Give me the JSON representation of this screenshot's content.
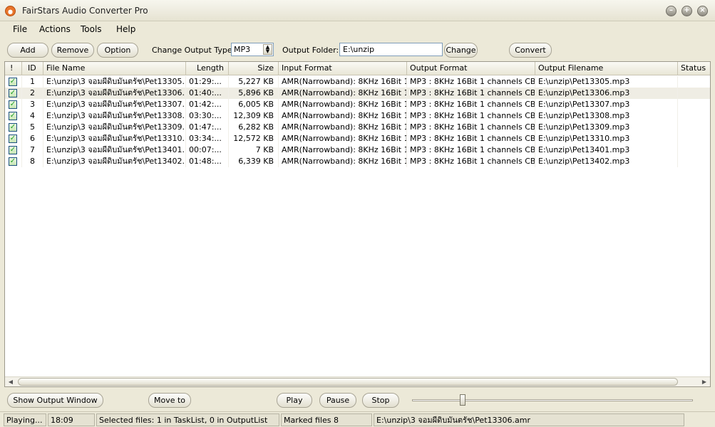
{
  "window": {
    "title": "FairStars Audio Converter Pro"
  },
  "menu": {
    "file": "File",
    "actions": "Actions",
    "tools": "Tools",
    "help": "Help"
  },
  "toolbar": {
    "add": "Add",
    "remove": "Remove",
    "option": "Option",
    "output_type_label": "Change Output Type:",
    "output_type_value": "MP3",
    "output_folder_label": "Output Folder:",
    "output_folder_value": "E:\\unzip",
    "change": "Change",
    "convert": "Convert"
  },
  "columns": [
    "!",
    "ID",
    "File Name",
    "Length",
    "Size",
    "Input Format",
    "Output Format",
    "Output Filename",
    "Status"
  ],
  "rows": [
    {
      "checked": true,
      "id": "1",
      "file": "E:\\unzip\\3 จอมผีดิบมันตรัช\\Pet13305...",
      "length": "01:29:...",
      "size": "5,227 KB",
      "input": "AMR(Narrowband): 8KHz 16Bit 1...",
      "output": "MP3 : 8KHz 16Bit 1 channels CB...",
      "outfile": "E:\\unzip\\Pet13305.mp3",
      "status": ""
    },
    {
      "checked": true,
      "id": "2",
      "file": "E:\\unzip\\3 จอมผีดิบมันตรัช\\Pet13306...",
      "length": "01:40:...",
      "size": "5,896 KB",
      "input": "AMR(Narrowband): 8KHz 16Bit 1...",
      "output": "MP3 : 8KHz 16Bit 1 channels CB...",
      "outfile": "E:\\unzip\\Pet13306.mp3",
      "status": ""
    },
    {
      "checked": true,
      "id": "3",
      "file": "E:\\unzip\\3 จอมผีดิบมันตรัช\\Pet13307...",
      "length": "01:42:...",
      "size": "6,005 KB",
      "input": "AMR(Narrowband): 8KHz 16Bit 1...",
      "output": "MP3 : 8KHz 16Bit 1 channels CB...",
      "outfile": "E:\\unzip\\Pet13307.mp3",
      "status": ""
    },
    {
      "checked": true,
      "id": "4",
      "file": "E:\\unzip\\3 จอมผีดิบมันตรัช\\Pet13308...",
      "length": "03:30:...",
      "size": "12,309 KB",
      "input": "AMR(Narrowband): 8KHz 16Bit 1...",
      "output": "MP3 : 8KHz 16Bit 1 channels CB...",
      "outfile": "E:\\unzip\\Pet13308.mp3",
      "status": ""
    },
    {
      "checked": true,
      "id": "5",
      "file": "E:\\unzip\\3 จอมผีดิบมันตรัช\\Pet13309...",
      "length": "01:47:...",
      "size": "6,282 KB",
      "input": "AMR(Narrowband): 8KHz 16Bit 1...",
      "output": "MP3 : 8KHz 16Bit 1 channels CB...",
      "outfile": "E:\\unzip\\Pet13309.mp3",
      "status": ""
    },
    {
      "checked": true,
      "id": "6",
      "file": "E:\\unzip\\3 จอมผีดิบมันตรัช\\Pet13310...",
      "length": "03:34:...",
      "size": "12,572 KB",
      "input": "AMR(Narrowband): 8KHz 16Bit 1...",
      "output": "MP3 : 8KHz 16Bit 1 channels CB...",
      "outfile": "E:\\unzip\\Pet13310.mp3",
      "status": ""
    },
    {
      "checked": true,
      "id": "7",
      "file": "E:\\unzip\\3 จอมผีดิบมันตรัช\\Pet13401...",
      "length": "00:07:...",
      "size": "7 KB",
      "input": "AMR(Narrowband): 8KHz 16Bit 1...",
      "output": "MP3 : 8KHz 16Bit 1 channels CB...",
      "outfile": "E:\\unzip\\Pet13401.mp3",
      "status": ""
    },
    {
      "checked": true,
      "id": "8",
      "file": "E:\\unzip\\3 จอมผีดิบมันตรัช\\Pet13402...",
      "length": "01:48:...",
      "size": "6,339 KB",
      "input": "AMR(Narrowband): 8KHz 16Bit 1...",
      "output": "MP3 : 8KHz 16Bit 1 channels CB...",
      "outfile": "E:\\unzip\\Pet13402.mp3",
      "status": ""
    }
  ],
  "selected_row_index": 1,
  "bottom": {
    "show_output": "Show Output Window",
    "move_to": "Move to",
    "play": "Play",
    "pause": "Pause",
    "stop": "Stop",
    "volume_level": 0.18
  },
  "status": {
    "state": "Playing...",
    "time": "18:09",
    "selected": "Selected files: 1 in TaskList, 0 in OutputList",
    "marked": "Marked files 8",
    "current_file": "E:\\unzip\\3 จอมผีดิบมันตรัช\\Pet13306.amr"
  }
}
